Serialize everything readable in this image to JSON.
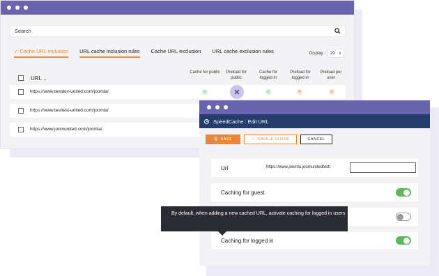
{
  "main_window": {
    "search": {
      "placeholder": "Search"
    },
    "tabs": [
      {
        "label": "✓ Cache URL inclusion"
      },
      {
        "label": "URL cache inclusion rules"
      },
      {
        "label": "Cache URL exclusion"
      },
      {
        "label": "URL cache exclusion rules"
      }
    ],
    "display_label": "Display :",
    "display_value": "20",
    "columns": {
      "url": "URL",
      "cache_public": "Cache for public",
      "preload_public": "Preload for public",
      "cache_logged": "Cache for logged in",
      "preload_logged": "Preload for logged in",
      "preload_user": "Preload per user"
    },
    "rows": [
      {
        "url": "https://www.testdev-united.com/joomla/"
      },
      {
        "url": "https://www.testtest-united.com/joomla/"
      },
      {
        "url": "https://www.joomunited.com/joomla/"
      }
    ]
  },
  "edit_window": {
    "title": "SpeedCache : Edit URL",
    "buttons": {
      "save": "SAVE",
      "save_close": "SAVE & CLOSE",
      "cancel": "CANCEL"
    },
    "url_label": "Url",
    "url_value": "https://www.joomla.joomunitedtest/",
    "caching_guest_label": "Caching for guest",
    "caching_guest_on": true,
    "caching_hidden_on": false,
    "caching_logged_label": "Caching for logged in",
    "caching_logged_on": true
  },
  "tooltip": {
    "text": "By default, when adding a new cached URL, activate caching for logged in users"
  },
  "colors": {
    "titlebar": "#6a64ad",
    "accent_orange": "#f0852d",
    "speedcache_bar": "#243c6a",
    "toggle_on": "#5cb85c"
  }
}
